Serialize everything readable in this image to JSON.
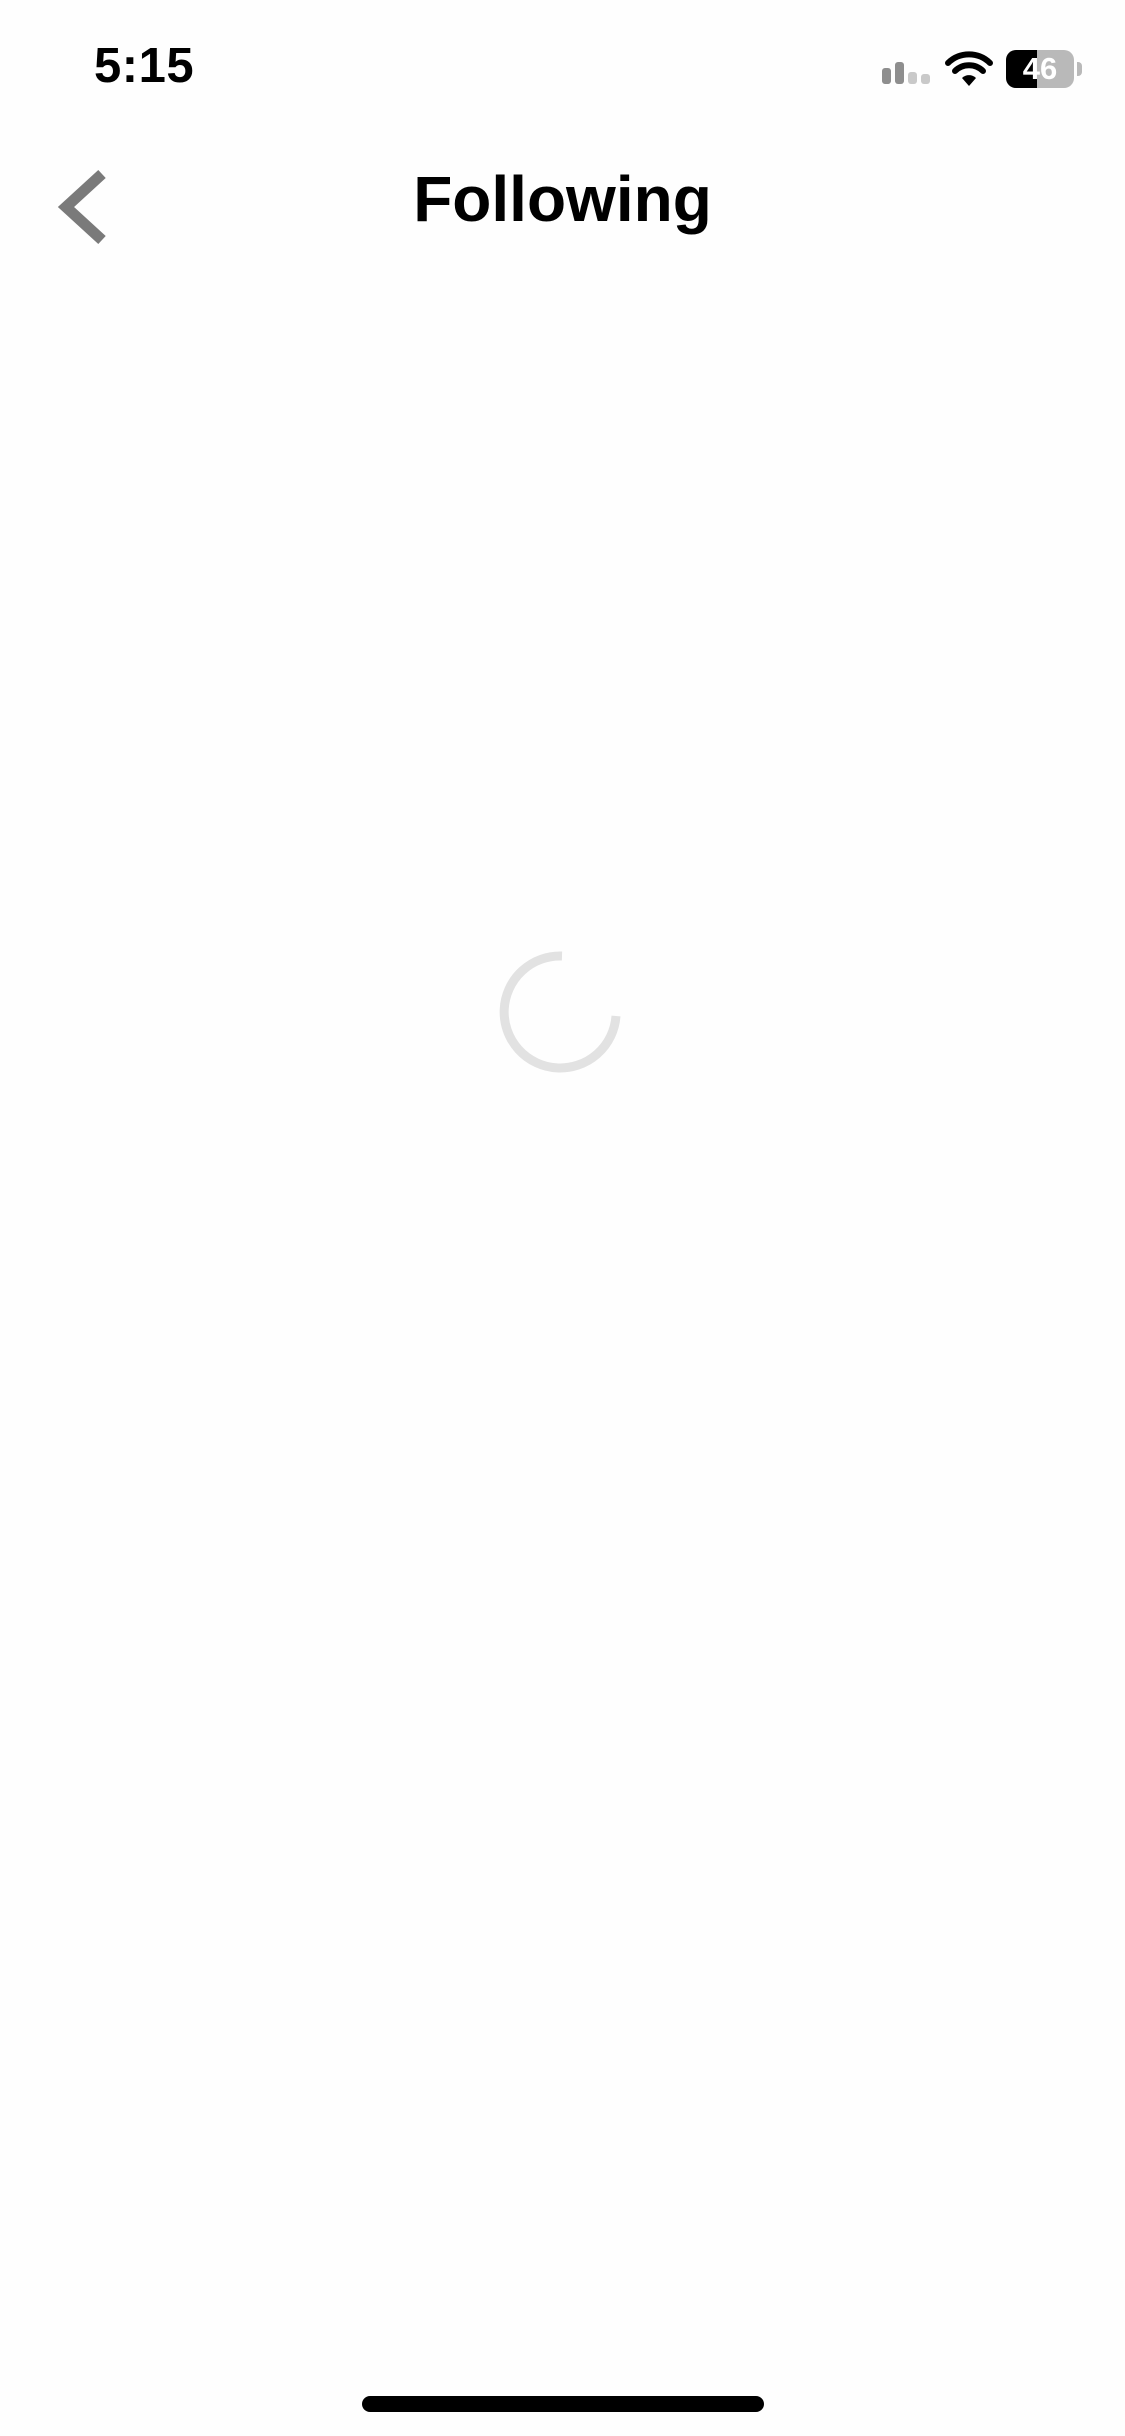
{
  "status_bar": {
    "time": "5:15",
    "battery_level": "46",
    "battery_fraction": 0.46,
    "icons": [
      "cellular-signal-icon",
      "wifi-icon",
      "battery-icon"
    ]
  },
  "nav": {
    "title": "Following",
    "back_icon": "chevron-left-icon"
  },
  "content": {
    "state": "loading",
    "spinner_icon": "loading-spinner-icon"
  },
  "colors": {
    "background": "#fefefe",
    "title": "#000000",
    "back_chevron": "#7a7a7a",
    "spinner": "#e2e2e2"
  }
}
